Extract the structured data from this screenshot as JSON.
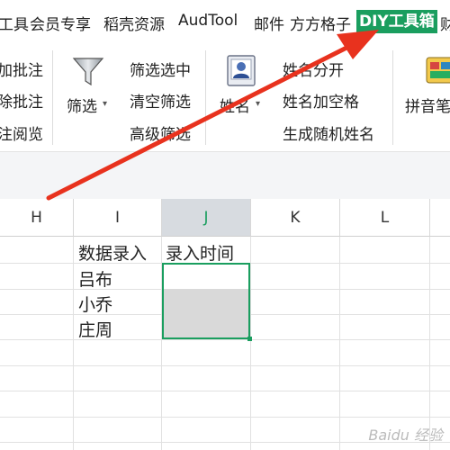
{
  "menubar": {
    "items": [
      "工具",
      "会员专享",
      "稻壳资源",
      "AudTool",
      "邮件",
      "方方格子",
      "DIY工具箱",
      "财"
    ]
  },
  "ribbon": {
    "left_cut": [
      "加批注",
      "除批注",
      "注阅览"
    ],
    "filter_label": "筛选",
    "filter_commands": [
      "筛选选中",
      "清空筛选",
      "高级筛选"
    ],
    "name_label": "姓名",
    "name_commands": [
      "姓名分开",
      "姓名加空格",
      "生成随机姓名"
    ],
    "pinyin_label": "拼音笔"
  },
  "grid": {
    "columns": [
      "H",
      "I",
      "J",
      "K",
      "L"
    ],
    "selected_column": "J",
    "cells": {
      "I1": "数据录入",
      "J1": "录入时间",
      "I2": "吕布",
      "I3": "小乔",
      "I4": "庄周"
    }
  },
  "watermark": "Baidu 经验",
  "colors": {
    "accent": "#1a9e5f",
    "arrow": "#e8321e"
  }
}
